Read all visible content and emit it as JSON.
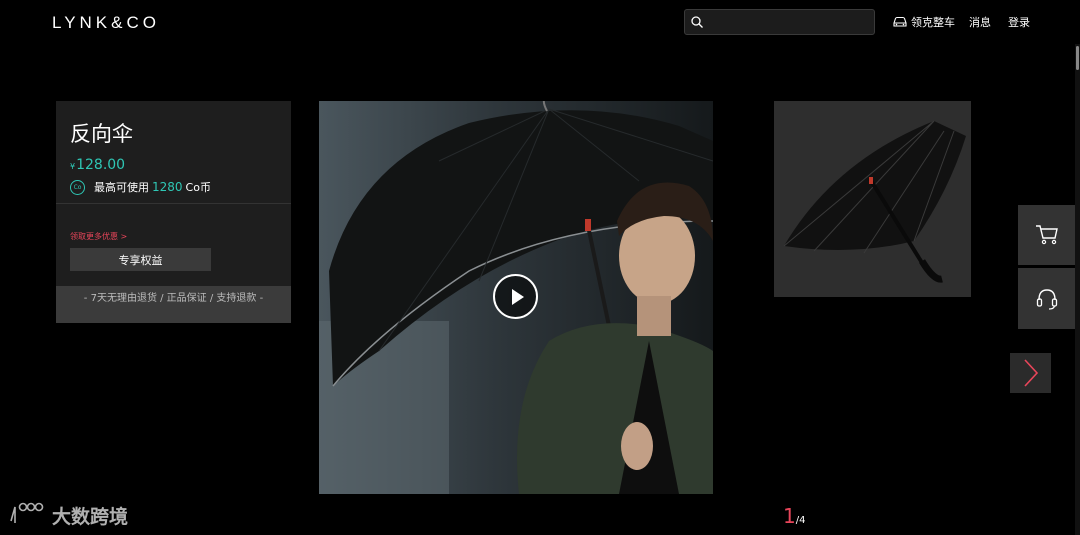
{
  "header": {
    "logo_text": "LYNK&CO",
    "search": {
      "value": "",
      "placeholder": ""
    },
    "nav": {
      "car_label": "领克整车",
      "messages_label": "消息",
      "login_label": "登录"
    }
  },
  "product": {
    "name": "反向伞",
    "currency_symbol": "¥",
    "price": "128.00",
    "coin_icon_text": "Co",
    "coin_prefix": "最高可使用",
    "coin_amount": "1280",
    "coin_suffix": "Co币",
    "promo_link": "领取更多优惠 >",
    "benefit_button": "专享权益",
    "guarantee_text": "- 7天无理由退货 / 正品保证 / 支持退款 -"
  },
  "gallery": {
    "current_page": "1",
    "total_pages": "/4"
  },
  "watermark": {
    "text": "大数跨境"
  },
  "colors": {
    "accent_teal": "#2fc7b5",
    "accent_red": "#e8455a",
    "background": "#000000",
    "panel": "#1e1e1e"
  },
  "icons": [
    "search-icon",
    "car-icon",
    "play-icon",
    "cart-icon",
    "headset-icon",
    "chevron-right-icon"
  ]
}
